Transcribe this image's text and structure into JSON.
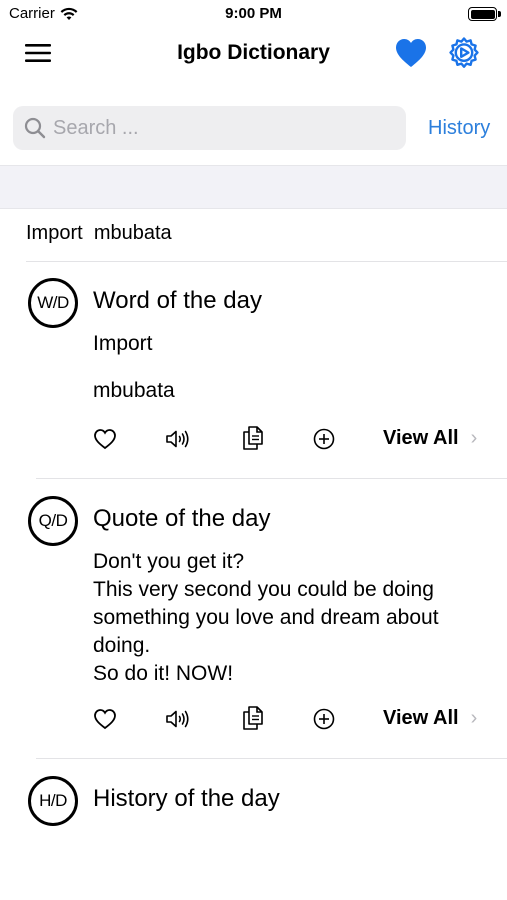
{
  "status_bar": {
    "carrier": "Carrier",
    "time": "9:00 PM"
  },
  "nav": {
    "title": "Igbo Dictionary"
  },
  "search": {
    "placeholder": "Search ...",
    "history_label": "History"
  },
  "import_row": {
    "label": "Import",
    "word": "mbubata"
  },
  "colors": {
    "accent": "#2c7fdc",
    "heart": "#1a73e8",
    "band": "#f2f2f7"
  },
  "cards": [
    {
      "badge": "W/D",
      "title": "Word of the day",
      "line1": "Import",
      "line2": "mbubata",
      "view_all": "View All"
    },
    {
      "badge": "Q/D",
      "title": "Quote of the day",
      "text": "Don't you get it?\nThis very second you could be doing something you love and dream about doing.\nSo do it! NOW!",
      "view_all": "View All"
    },
    {
      "badge": "H/D",
      "title": "History of the day"
    }
  ],
  "icons": [
    "wifi-icon",
    "battery-icon",
    "menu-icon",
    "heart-icon",
    "gear-icon",
    "search-icon",
    "favorite-outline-icon",
    "speaker-icon",
    "copy-icon",
    "add-circle-icon",
    "chevron-right-icon"
  ]
}
